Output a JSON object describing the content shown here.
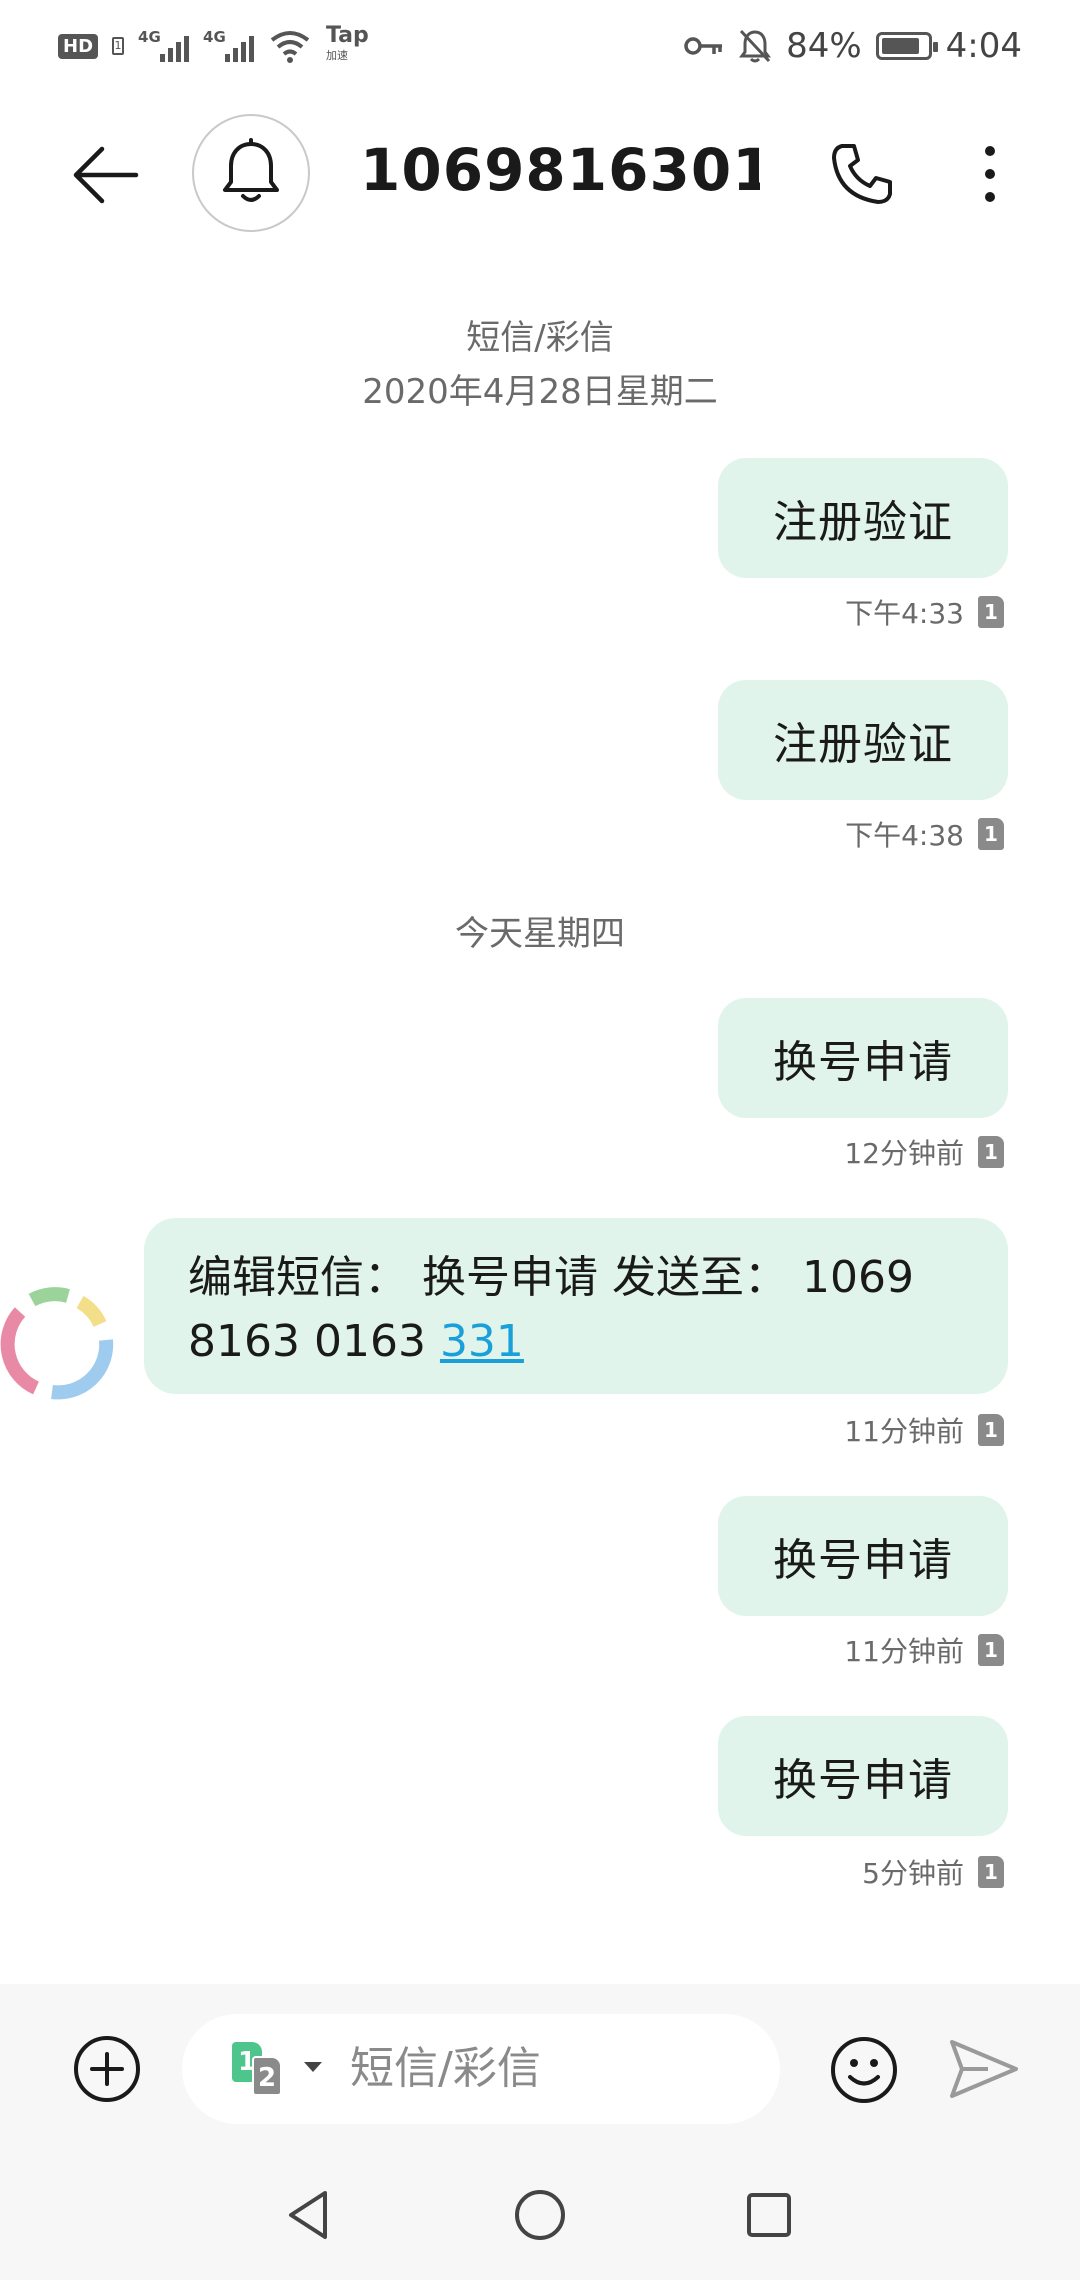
{
  "status_bar": {
    "hd": "HD",
    "sim_slot": "1",
    "network_1": "4G",
    "network_2": "4G",
    "tap_label": "Tap",
    "tap_sub": "加速",
    "icons": [
      "key-icon",
      "bell-off-icon",
      "battery-icon",
      "wifi-icon"
    ],
    "battery_percent": "84%",
    "battery_level": 0.84,
    "time": "4:04"
  },
  "header": {
    "contact_name": "1069816301…",
    "avatar_icon": "bell-icon"
  },
  "conversation": {
    "channel_label": "短信/彩信",
    "date_1": "2020年4月28日星期二",
    "date_2": "今天星期四",
    "messages": [
      {
        "text": "注册验证",
        "time": "下午4:33",
        "sim": "1"
      },
      {
        "text": "注册验证",
        "time": "下午4:38",
        "sim": "1"
      },
      {
        "text": "换号申请",
        "time": "12分钟前",
        "sim": "1"
      },
      {
        "text_prefix": "编辑短信： 换号申请 发送至： 1069 8163 0163 ",
        "text_link": "331",
        "time": "11分钟前",
        "sim": "1"
      },
      {
        "text": "换号申请",
        "time": "11分钟前",
        "sim": "1"
      },
      {
        "text": "换号申请",
        "time": "5分钟前",
        "sim": "1"
      }
    ]
  },
  "compose": {
    "sim_primary": "1",
    "sim_secondary": "2",
    "placeholder": "短信/彩信"
  },
  "colors": {
    "bubble": "#e0f4ec",
    "link": "#1b9fd9",
    "sim_active": "#4ec58a"
  }
}
